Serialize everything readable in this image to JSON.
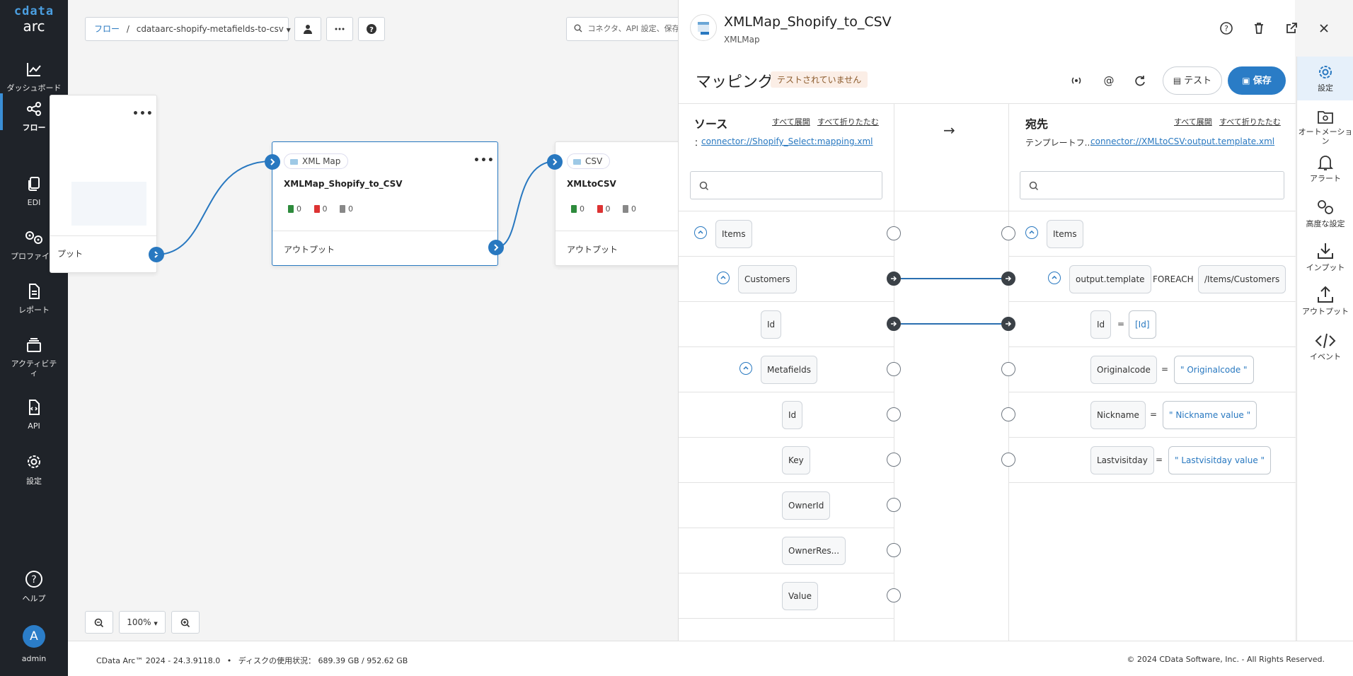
{
  "nav": {
    "logo_top": "cdata",
    "logo_bottom": "arc",
    "items": [
      {
        "label": "ダッシュボード",
        "icon": "chart-icon"
      },
      {
        "label": "フロー",
        "icon": "flow-icon"
      },
      {
        "label": "EDI",
        "icon": "documents-icon"
      },
      {
        "label": "プロファイル",
        "icon": "gears-icon"
      },
      {
        "label": "レポート",
        "icon": "report-icon"
      },
      {
        "label": "アクティビティ",
        "icon": "activity-icon"
      },
      {
        "label": "API",
        "icon": "api-icon"
      },
      {
        "label": "設定",
        "icon": "gear-icon"
      }
    ],
    "help_label": "ヘルプ",
    "user_initial": "A",
    "user_label": "admin"
  },
  "toolbar": {
    "breadcrumb_root": "フロー",
    "breadcrumb_sep": "/",
    "flow_name": "cdataarc-shopify-metafields-to-csv",
    "search_placeholder": "コネクタ、API 設定、保存"
  },
  "canvas": {
    "left_card_output": "プット",
    "xmlmap_card": {
      "badge": "XML Map",
      "title": "XMLMap_Shopify_to_CSV",
      "counts": [
        "0",
        "0",
        "0"
      ],
      "output": "アウトプット"
    },
    "csv_card": {
      "badge": "CSV",
      "title": "XMLtoCSV",
      "counts": [
        "0",
        "0",
        "0"
      ],
      "output": "アウトプット"
    },
    "zoom_level": "100%"
  },
  "panel": {
    "title": "XMLMap_Shopify_to_CSV",
    "subtitle": "XMLMap",
    "mapping_title": "マッピング",
    "status": "テストされていません",
    "test_label": "テスト",
    "save_label": "保存",
    "source": {
      "heading": "ソース",
      "expand_all": "すべて展開",
      "collapse_all": "すべて折りたたむ",
      "path_prefix": "：",
      "path": "connector://Shopify_Select:mapping.xml"
    },
    "arrow": "→",
    "dest": {
      "heading": "宛先",
      "expand_all": "すべて展開",
      "collapse_all": "すべて折りたたむ",
      "path_label": "テンプレートフ...",
      "path": "connector://XMLtoCSV:output.template.xml"
    },
    "source_nodes": [
      "Items",
      "Customers",
      "Id",
      "Metafields",
      "Id",
      "Key",
      "OwnerId",
      "OwnerRes...",
      "Value"
    ],
    "dest_nodes": {
      "items": "Items",
      "output_template": "output.template",
      "foreach": "FOREACH",
      "foreach_path": "/Items/Customers",
      "id": "Id",
      "id_value": "[Id]",
      "originalcode": "Originalcode",
      "originalcode_value": "\" Originalcode \"",
      "nickname": "Nickname",
      "nickname_value": "\" Nickname value \"",
      "lastvisitday": "Lastvisitday",
      "lastvisitday_value": "\" Lastvisitday value \"",
      "eq": "="
    }
  },
  "rail": {
    "items": [
      {
        "label": "設定",
        "icon": "settings-icon"
      },
      {
        "label": "オートメーション",
        "icon": "automation-icon"
      },
      {
        "label": "アラート",
        "icon": "bell-icon"
      },
      {
        "label": "高度な設定",
        "icon": "advanced-gears-icon"
      },
      {
        "label": "インプット",
        "icon": "download-icon"
      },
      {
        "label": "アウトプット",
        "icon": "upload-icon"
      },
      {
        "label": "イベント",
        "icon": "code-icon"
      }
    ]
  },
  "footer": {
    "version": "CData Arc™ 2024 - 24.3.9118.0",
    "disk": "ディスクの使用状況： 689.39 GB / 952.62 GB",
    "copyright": "© 2024 CData Software, Inc. - All Rights Reserved."
  },
  "colors": {
    "accent": "#2878c0",
    "nav_bg": "#1f2329",
    "status_bg": "#fbeee6",
    "save_bg": "#2a7cc6"
  }
}
